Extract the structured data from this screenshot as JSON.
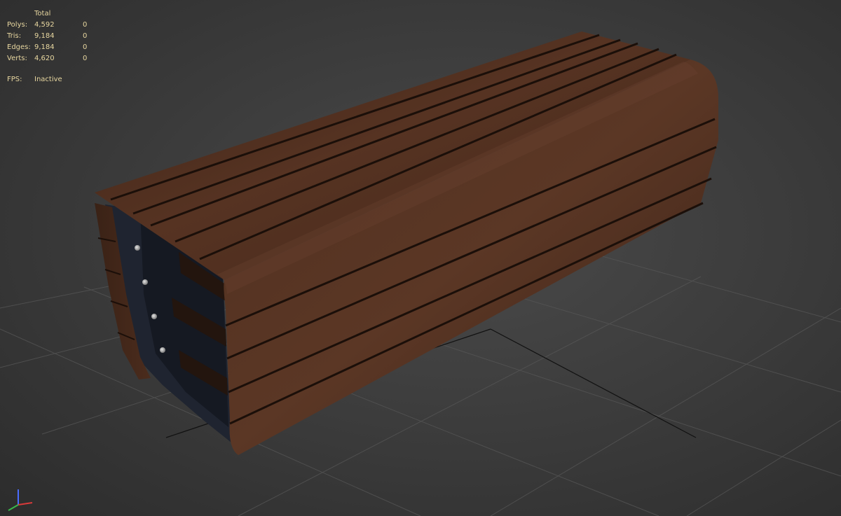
{
  "stats": {
    "header": "Total",
    "rows": [
      {
        "label": "Polys:",
        "total": "4,592",
        "selected": "0"
      },
      {
        "label": "Tris:",
        "total": "9,184",
        "selected": "0"
      },
      {
        "label": "Edges:",
        "total": "9,184",
        "selected": "0"
      },
      {
        "label": "Verts:",
        "total": "4,620",
        "selected": "0"
      }
    ],
    "fps": {
      "label": "FPS:",
      "value": "Inactive"
    }
  },
  "viewport": {
    "object": "wooden-bench",
    "colors": {
      "wood": "#4e2e1d",
      "wood_dark": "#2a170e",
      "steel": "#1f2430",
      "grid": "#5a5a5a",
      "text": "#e8d7a0"
    }
  },
  "gizmo": {
    "axes": [
      "x-axis-icon",
      "y-axis-icon",
      "z-axis-icon"
    ]
  }
}
